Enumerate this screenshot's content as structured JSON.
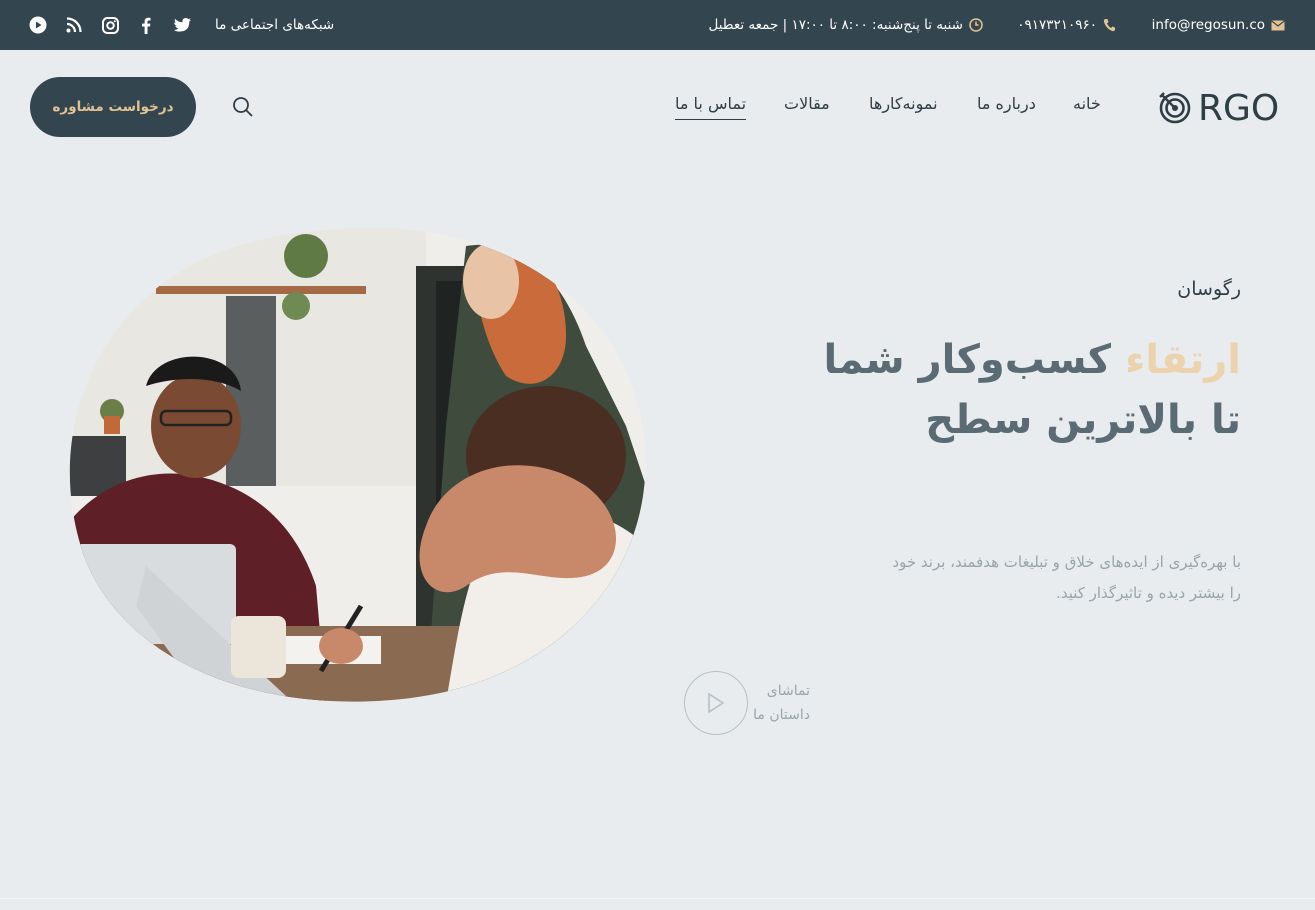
{
  "topbar": {
    "email": "info@regosun.co",
    "phone": "۰۹۱۷۳۲۱۰۹۶۰",
    "hours": "شنبه تا پنج‌شنبه: ۸:۰۰ تا ۱۷:۰۰ | جمعه تعطیل",
    "socials_label": "شبکه‌های اجتماعی ما",
    "social_icons": [
      "youtube-icon",
      "rss-icon",
      "instagram-icon",
      "facebook-icon",
      "twitter-icon"
    ]
  },
  "header": {
    "logo_text": "RGO",
    "nav": [
      "خانه",
      "درباره ما",
      "نمونه‌کارها",
      "مقالات",
      "تماس با ما"
    ],
    "active_nav": "تماس با ما",
    "cta_label": "درخواست مشاوره"
  },
  "hero": {
    "brand": "رگوسان",
    "headline_accent": "ارتقاء",
    "headline_rest": " کسب‌وکار شما تا بالاترین سطح",
    "description": "با بهره‌گیری از ایده‌های خلاق و تبلیغات هدفمند، برند خود را بیشتر دیده و تاثیرگذار کنید.",
    "watch_line1": "تماشای",
    "watch_line2": "داستان ما"
  },
  "colors": {
    "topbar_bg": "#33454f",
    "accent_gold": "#e3c393",
    "page_bg": "#e8ecef",
    "headline_gray": "#5b6b73"
  }
}
